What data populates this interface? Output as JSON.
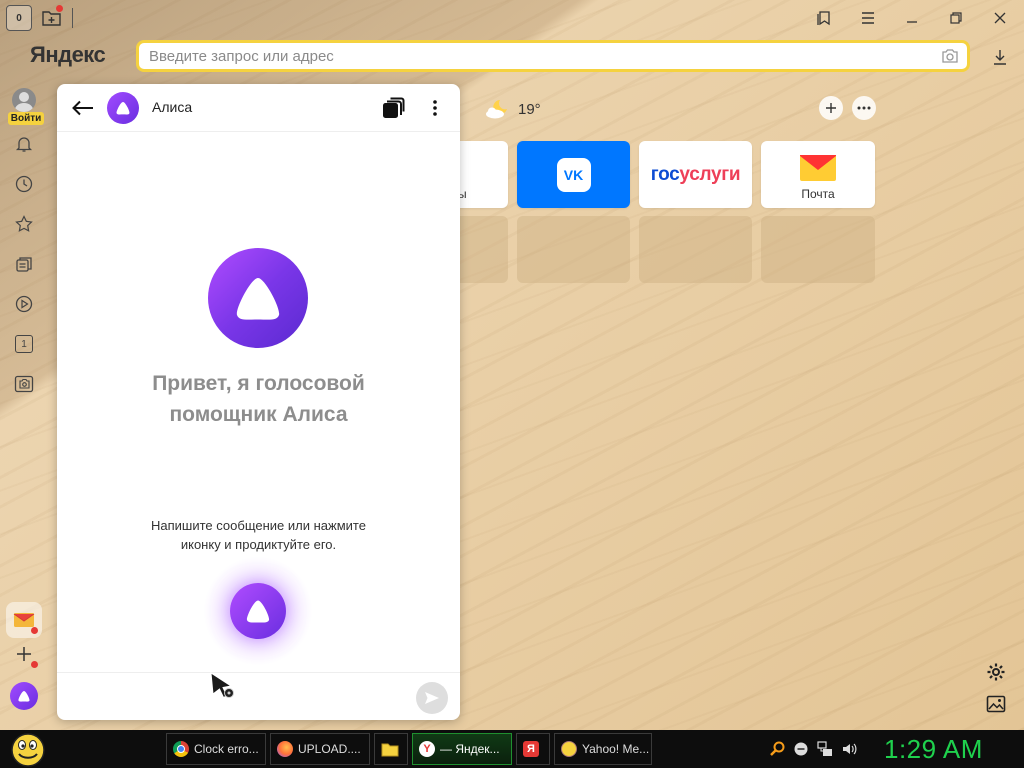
{
  "browser": {
    "logo": "Яндекс",
    "home_badge": "0",
    "omnibox_placeholder": "Введите запрос или адрес"
  },
  "sidebar": {
    "login_label": "Войти",
    "badge_one": "1"
  },
  "alice": {
    "title": "Алиса",
    "greeting_line1": "Привет, я голосовой",
    "greeting_line2": "помощник Алиса",
    "hint_line1": "Напишите сообщение или нажмите",
    "hint_line2": "иконку и продиктуйте его."
  },
  "newtab": {
    "weather_temp": "19°",
    "tiles": {
      "partial_label": "ы",
      "vk_label": "VK",
      "gos_part1": "гос",
      "gos_part2": "услуги",
      "mail_label": "Почта"
    }
  },
  "taskbar": {
    "tasks": [
      {
        "label": "Clock erro..."
      },
      {
        "label": "UPLOAD...."
      },
      {
        "label": ""
      },
      {
        "label": "— Яндек..."
      },
      {
        "label": ""
      },
      {
        "label": "Yahoo! Me..."
      }
    ],
    "clock": "1:29 AM"
  },
  "colors": {
    "accent_yellow": "#f5d23f",
    "alice_purple": "#7a36e8",
    "vk_blue": "#0077ff",
    "gos_blue": "#0d4cd3",
    "gos_red": "#ee3f58",
    "clock_green": "#1fd14d"
  }
}
